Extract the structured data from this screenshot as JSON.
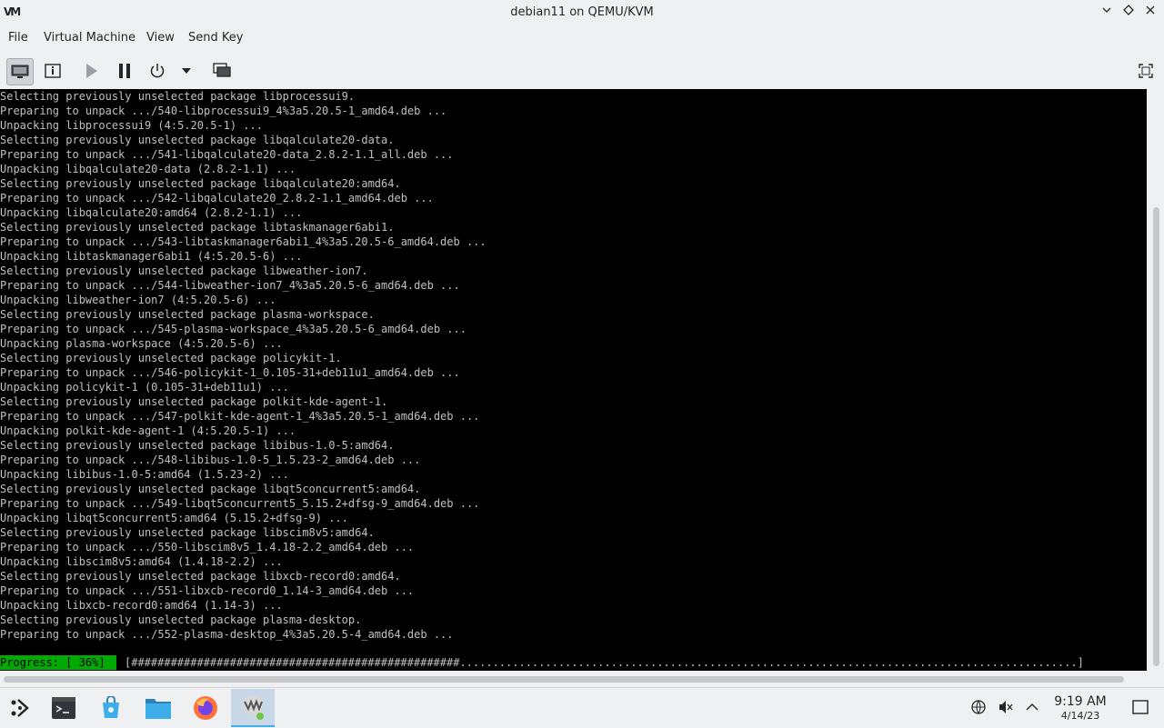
{
  "window": {
    "title": "debian11 on QEMU/KVM",
    "logo_text": "VM",
    "controls": [
      "minimize-icon",
      "maximize-icon",
      "close-icon"
    ]
  },
  "menu": [
    "File",
    "Virtual Machine",
    "View",
    "Send Key"
  ],
  "toolbar": {
    "buttons": [
      "console-icon",
      "details-icon",
      "run-icon",
      "pause-icon",
      "power-icon",
      "dropdown-arrow-icon",
      "snapshots-icon",
      "fullscreen-icon"
    ]
  },
  "console": {
    "lines": [
      "Selecting previously unselected package libprocessui9.",
      "Preparing to unpack .../540-libprocessui9_4%3a5.20.5-1_amd64.deb ...",
      "Unpacking libprocessui9 (4:5.20.5-1) ...",
      "Selecting previously unselected package libqalculate20-data.",
      "Preparing to unpack .../541-libqalculate20-data_2.8.2-1.1_all.deb ...",
      "Unpacking libqalculate20-data (2.8.2-1.1) ...",
      "Selecting previously unselected package libqalculate20:amd64.",
      "Preparing to unpack .../542-libqalculate20_2.8.2-1.1_amd64.deb ...",
      "Unpacking libqalculate20:amd64 (2.8.2-1.1) ...",
      "Selecting previously unselected package libtaskmanager6abi1.",
      "Preparing to unpack .../543-libtaskmanager6abi1_4%3a5.20.5-6_amd64.deb ...",
      "Unpacking libtaskmanager6abi1 (4:5.20.5-6) ...",
      "Selecting previously unselected package libweather-ion7.",
      "Preparing to unpack .../544-libweather-ion7_4%3a5.20.5-6_amd64.deb ...",
      "Unpacking libweather-ion7 (4:5.20.5-6) ...",
      "Selecting previously unselected package plasma-workspace.",
      "Preparing to unpack .../545-plasma-workspace_4%3a5.20.5-6_amd64.deb ...",
      "Unpacking plasma-workspace (4:5.20.5-6) ...",
      "Selecting previously unselected package policykit-1.",
      "Preparing to unpack .../546-policykit-1_0.105-31+deb11u1_amd64.deb ...",
      "Unpacking policykit-1 (0.105-31+deb11u1) ...",
      "Selecting previously unselected package polkit-kde-agent-1.",
      "Preparing to unpack .../547-polkit-kde-agent-1_4%3a5.20.5-1_amd64.deb ...",
      "Unpacking polkit-kde-agent-1 (4:5.20.5-1) ...",
      "Selecting previously unselected package libibus-1.0-5:amd64.",
      "Preparing to unpack .../548-libibus-1.0-5_1.5.23-2_amd64.deb ...",
      "Unpacking libibus-1.0-5:amd64 (1.5.23-2) ...",
      "Selecting previously unselected package libqt5concurrent5:amd64.",
      "Preparing to unpack .../549-libqt5concurrent5_5.15.2+dfsg-9_amd64.deb ...",
      "Unpacking libqt5concurrent5:amd64 (5.15.2+dfsg-9) ...",
      "Selecting previously unselected package libscim8v5:amd64.",
      "Preparing to unpack .../550-libscim8v5_1.4.18-2.2_amd64.deb ...",
      "Unpacking libscim8v5:amd64 (1.4.18-2.2) ...",
      "Selecting previously unselected package libxcb-record0:amd64.",
      "Preparing to unpack .../551-libxcb-record0_1.14-3_amd64.deb ...",
      "Unpacking libxcb-record0:amd64 (1.14-3) ...",
      "Selecting previously unselected package plasma-desktop.",
      "Preparing to unpack .../552-plasma-desktop_4%3a5.20.5-4_amd64.deb ..."
    ],
    "progress_label": "Progress: [ 36%]",
    "progress_bar": "[##################################################..............................................................................................]",
    "progress_percent": 36
  },
  "taskbar": {
    "apps": [
      "app-launcher-icon",
      "terminal-icon",
      "discover-icon",
      "file-manager-icon",
      "firefox-icon",
      "virt-manager-icon"
    ],
    "tray": [
      "network-icon",
      "volume-muted-icon",
      "tray-expand-icon",
      "show-desktop-icon"
    ],
    "time": "9:19 AM",
    "date": "4/14/23"
  },
  "colors": {
    "console_bg": "#000000",
    "console_text": "#c0c0c0",
    "progress_green": "#00aa00",
    "accent": "#3daee9"
  }
}
